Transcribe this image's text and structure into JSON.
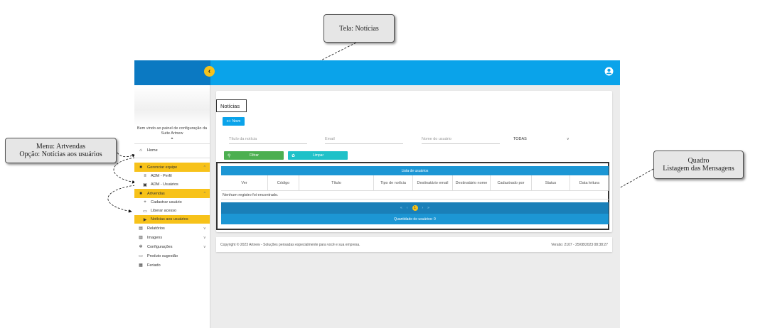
{
  "annotations": {
    "tela": "Tela: Notícias",
    "menu_line1": "Menu: Artvendas",
    "menu_line2": "Opção: Notícias aos usuários",
    "quadro_line1": "Quadro",
    "quadro_line2": "Listagem das Mensagens"
  },
  "colors": {
    "topbar": "#0aa3ea",
    "topbar_left": "#0b79c2",
    "highlight": "#f7c21a",
    "filter_button": "#4caf50",
    "clear_button": "#1fc1c8",
    "table_header": "#1c96d4"
  },
  "header": {
    "collapse_icon": "chevron-left-icon",
    "account_icon": "account-circle-icon"
  },
  "sidebar": {
    "welcome": "Bem vindo ao painel de configuração da Suite Artnew",
    "items": [
      {
        "label": "Home",
        "icon": "home-icon"
      },
      {
        "label": "Gerenciar equipe",
        "icon": "team-icon"
      },
      {
        "label": "ADM - Perfil",
        "icon": "list-icon"
      },
      {
        "label": "ADM - Usuários",
        "icon": "user-box-icon"
      },
      {
        "label": "Artvendas",
        "icon": "store-icon"
      },
      {
        "label": "Cadastrar usuário",
        "icon": "user-add-icon"
      },
      {
        "label": "Liberar acesso",
        "icon": "key-icon"
      },
      {
        "label": "Notícias aos usuários",
        "icon": "send-icon"
      },
      {
        "label": "Relatórios",
        "icon": "report-icon"
      },
      {
        "label": "Imagens",
        "icon": "image-icon"
      },
      {
        "label": "Configurações",
        "icon": "gear-icon"
      },
      {
        "label": "Produto sugestão",
        "icon": "product-icon"
      },
      {
        "label": "Feriado",
        "icon": "calendar-icon"
      }
    ]
  },
  "main": {
    "title": "Notícias",
    "new_button": "Novo",
    "filters": {
      "title": "Título da notícia",
      "email": "Email",
      "user_name": "Nome do usuário",
      "status_selected": "TODAS"
    },
    "filter_button": "Filtrar",
    "clear_button": "Limpar",
    "table": {
      "title": "Lista de usuários",
      "columns": [
        "Ver",
        "Código",
        "Título",
        "Tipo de notícia",
        "Destinatário email",
        "Destinatário nome",
        "Cadastrado por",
        "Status",
        "Data leitura"
      ],
      "empty_message": "Nenhum registro foi encontrado.",
      "current_page": "1",
      "pager": {
        "first": "«",
        "prev": "‹",
        "next": "›",
        "last": "»"
      },
      "footer": "Quantidade de usuários: 0"
    },
    "footer": {
      "copyright": "Copyright © 2023 Artnew - Soluções pensadas especialmente para você e sua empresa.",
      "version": "Versão: 2107 - 25/08/2023 08:38:27"
    }
  }
}
